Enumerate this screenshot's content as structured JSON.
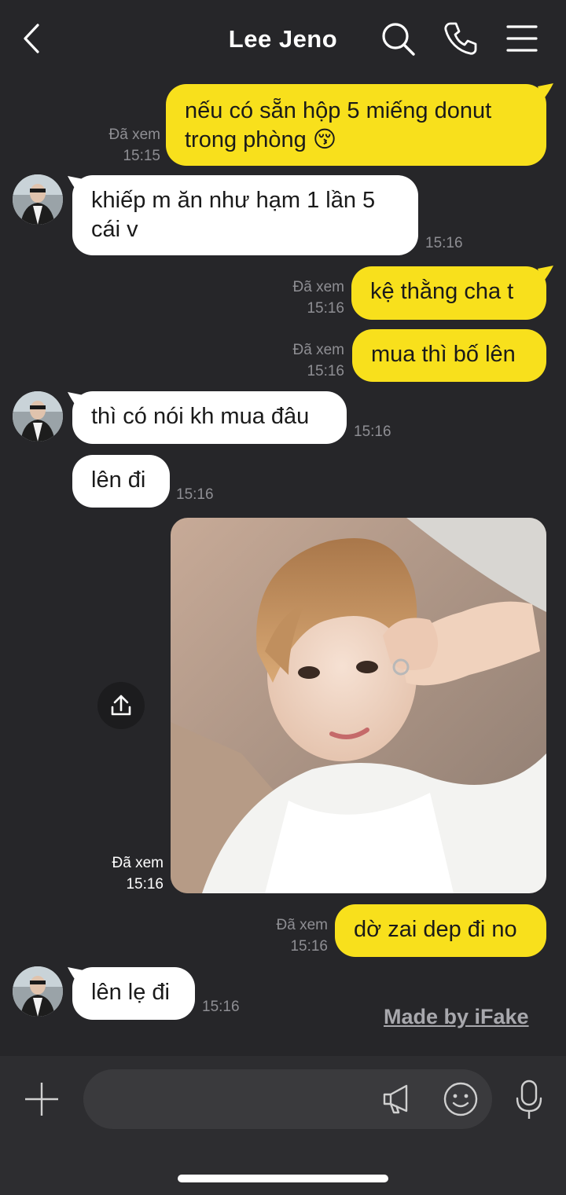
{
  "header": {
    "title": "Lee Jeno",
    "icons": [
      "back-chevron-icon",
      "search-icon",
      "phone-icon",
      "menu-icon"
    ]
  },
  "messages": {
    "m1": {
      "text_line1": "nếu có sẵn hộp 5 miếng donut",
      "text_line2": "trong phòng",
      "emoji": "😚",
      "seen": "Đã xem",
      "time": "15:15"
    },
    "m2": {
      "text_line1": "khiếp m ăn như hạm 1 lần 5",
      "text_line2": "cái v",
      "time": "15:16"
    },
    "m3": {
      "text": "kệ thằng cha t",
      "seen": "Đã xem",
      "time": "15:16"
    },
    "m4": {
      "text": "mua thì bố lên",
      "seen": "Đã xem",
      "time": "15:16"
    },
    "m5": {
      "text": "thì có nói kh mua đâu",
      "time": "15:16"
    },
    "m6": {
      "text": "lên đi",
      "time": "15:16"
    },
    "m7": {
      "type": "photo",
      "seen": "Đã xem",
      "time": "15:16"
    },
    "m8": {
      "text": "dờ zai dep đi no",
      "seen": "Đã xem",
      "time": "15:16"
    },
    "m9": {
      "text": "lên lẹ đi",
      "time": "15:16"
    }
  },
  "watermark": "Made by iFake",
  "input": {
    "placeholder": ""
  },
  "colors": {
    "background": "#262629",
    "outgoing_bubble": "#f8e01c",
    "incoming_bubble": "#ffffff",
    "meta_text": "#8e8e93",
    "bottom_bar": "#2d2d30"
  }
}
